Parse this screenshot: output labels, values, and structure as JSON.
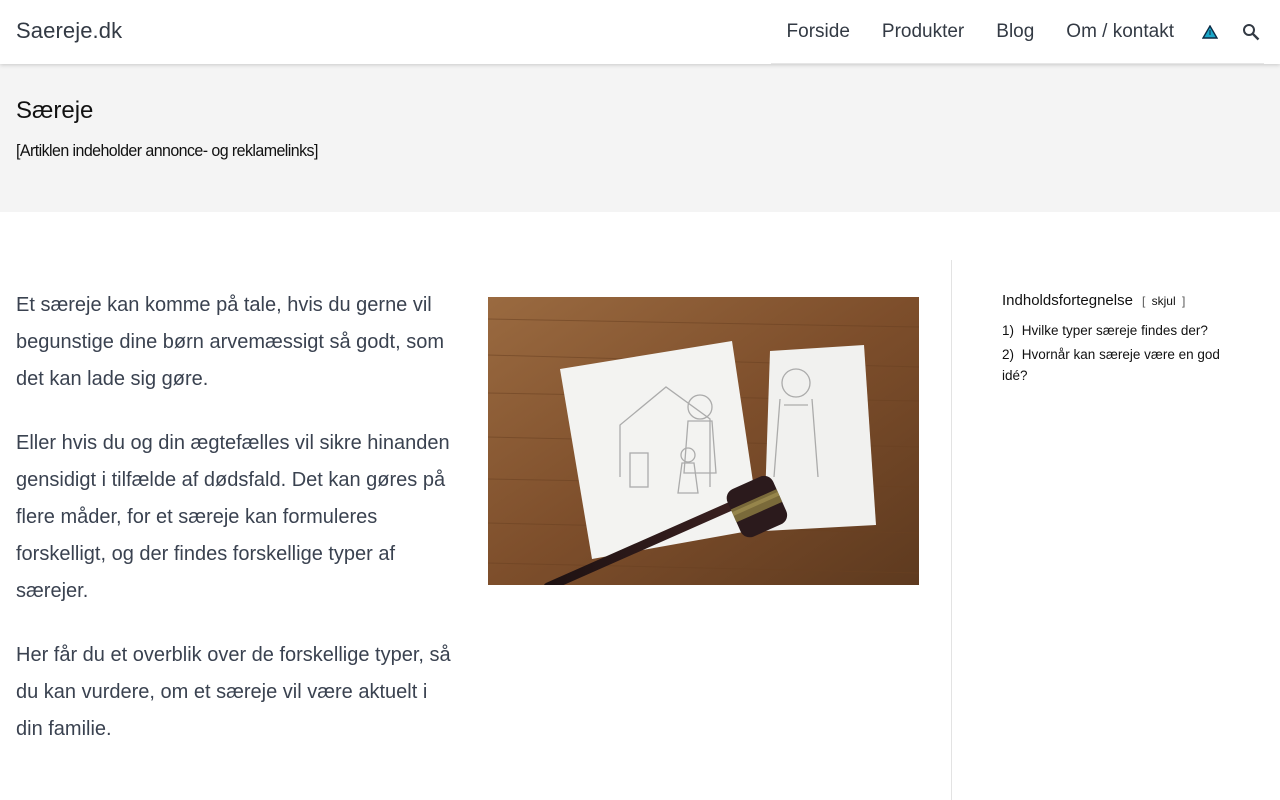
{
  "site": {
    "logo": "Saereje.dk"
  },
  "nav": {
    "items": [
      {
        "label": "Forside"
      },
      {
        "label": "Produkter"
      },
      {
        "label": "Blog"
      },
      {
        "label": "Om / kontakt"
      }
    ],
    "icons": [
      "triangle-logo-icon",
      "search-icon"
    ]
  },
  "page": {
    "title": "Særeje",
    "subtitle": "[Artiklen indeholder annonce- og reklamelinks]"
  },
  "article": {
    "paragraphs": [
      "Et særeje kan komme på tale, hvis du gerne vil begunstige dine børn arvemæssigt så godt, som det kan lade sig gøre.",
      "Eller hvis du og din ægtefælles vil sikre hinanden gensidigt i tilfælde af dødsfald. Det kan gøres på flere måder, for et særeje kan formuleres forskelligt, og der findes forskellige typer af særejer.",
      "Her får du et overblik over de forskellige typer, så du kan vurdere, om et særeje vil være aktuelt i din familie."
    ]
  },
  "toc": {
    "title": "Indholdsfortegnelse",
    "toggle_open": "[",
    "toggle_label": "skjul",
    "toggle_close": "]",
    "items": [
      {
        "num": "1)",
        "label": "Hvilke typer særeje findes der?"
      },
      {
        "num": "2)",
        "label": "Hvornår kan særeje være en god idé?"
      }
    ]
  },
  "colors": {
    "text": "#3a4250",
    "title_band": "#f4f4f4",
    "wood": "#8a5a34",
    "icon_cyan": "#1aa6c8"
  }
}
